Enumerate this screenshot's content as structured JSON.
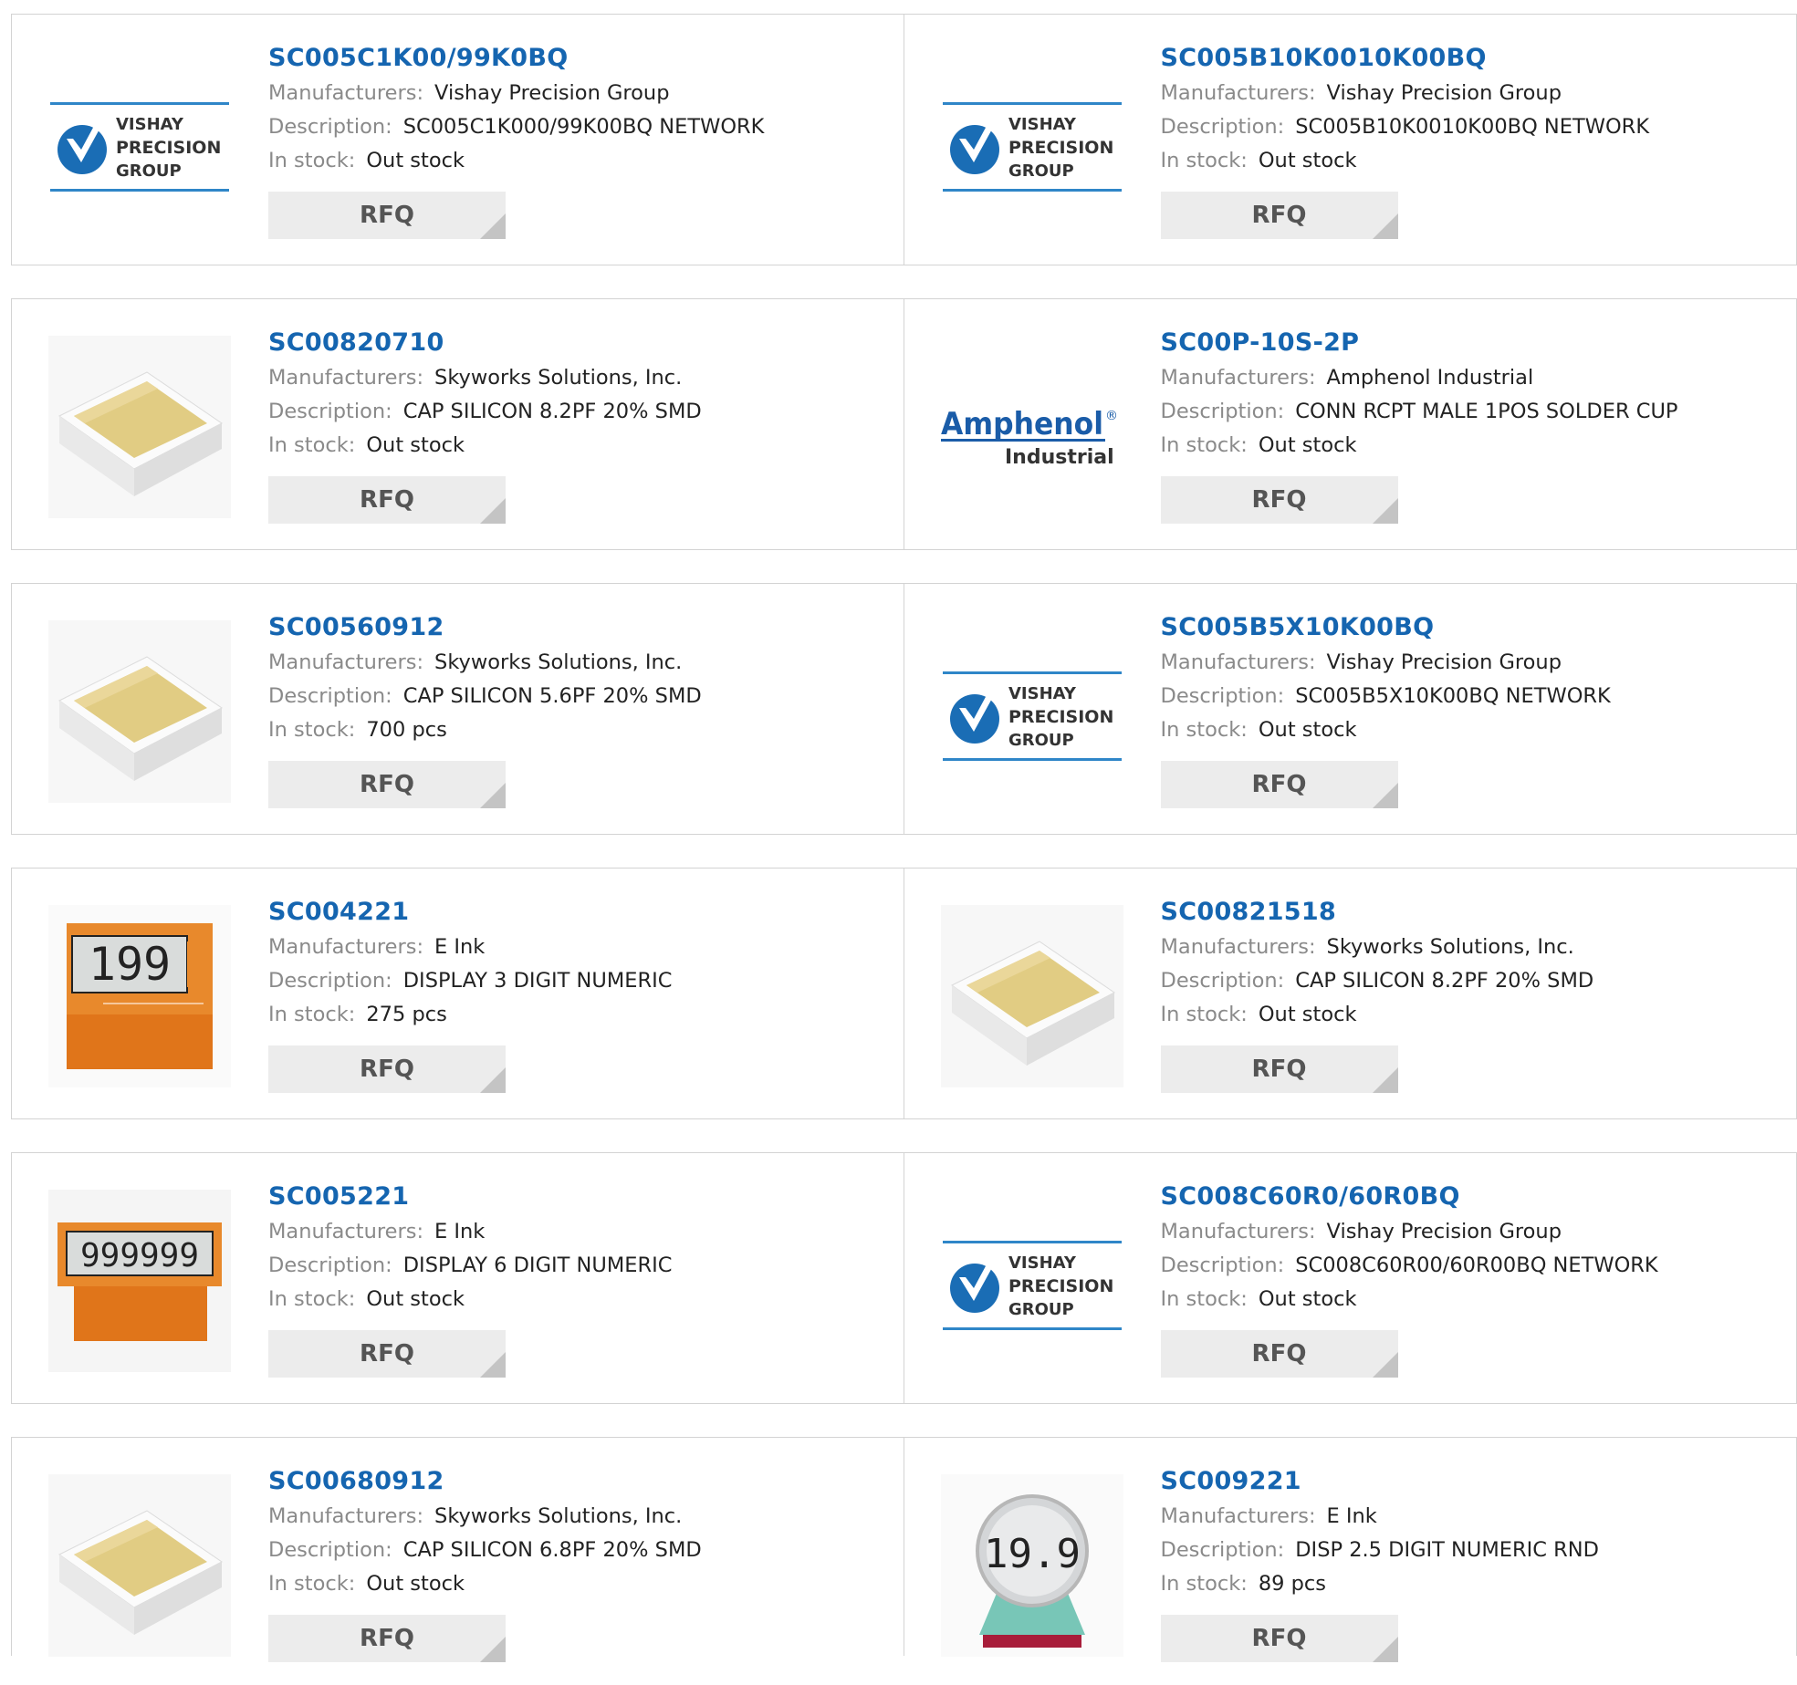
{
  "labels": {
    "manufacturers": "Manufacturers:",
    "description": "Description:",
    "in_stock": "In stock:",
    "rfq": "RFQ"
  },
  "logos": {
    "vishay": {
      "line1": "VISHAY",
      "line2": "PRECISION",
      "line3": "GROUP"
    },
    "amphenol": {
      "word": "Amphenol",
      "reg": "®",
      "sub": "Industrial"
    }
  },
  "colors": {
    "link": "#1565b0",
    "label": "#8a8a8a",
    "rfq_bg": "#ececec",
    "border": "#d3d3d3"
  },
  "products": [
    {
      "part": "SC005C1K00/99K0BQ",
      "manufacturer": "Vishay Precision Group",
      "description": "SC005C1K000/99K00BQ NETWORK",
      "stock": "Out stock",
      "image": "vishay-logo"
    },
    {
      "part": "SC005B10K0010K00BQ",
      "manufacturer": "Vishay Precision Group",
      "description": "SC005B10K0010K00BQ NETWORK",
      "stock": "Out stock",
      "image": "vishay-logo"
    },
    {
      "part": "SC00820710",
      "manufacturer": "Skyworks Solutions, Inc.",
      "description": "CAP SILICON 8.2PF 20% SMD",
      "stock": "Out stock",
      "image": "silicon-cap-chip"
    },
    {
      "part": "SC00P-10S-2P",
      "manufacturer": "Amphenol Industrial",
      "description": "CONN RCPT MALE 1POS SOLDER CUP",
      "stock": "Out stock",
      "image": "amphenol-logo"
    },
    {
      "part": "SC00560912",
      "manufacturer": "Skyworks Solutions, Inc.",
      "description": "CAP SILICON 5.6PF 20% SMD",
      "stock": "700 pcs",
      "image": "silicon-cap-chip"
    },
    {
      "part": "SC005B5X10K00BQ",
      "manufacturer": "Vishay Precision Group",
      "description": "SC005B5X10K00BQ NETWORK",
      "stock": "Out stock",
      "image": "vishay-logo"
    },
    {
      "part": "SC004221",
      "manufacturer": "E Ink",
      "description": "DISPLAY 3 DIGIT NUMERIC",
      "stock": "275 pcs",
      "image": "eink-3-digit-display",
      "digits": "199"
    },
    {
      "part": "SC00821518",
      "manufacturer": "Skyworks Solutions, Inc.",
      "description": "CAP SILICON 8.2PF 20% SMD",
      "stock": "Out stock",
      "image": "silicon-cap-chip"
    },
    {
      "part": "SC005221",
      "manufacturer": "E Ink",
      "description": "DISPLAY 6 DIGIT NUMERIC",
      "stock": "Out stock",
      "image": "eink-6-digit-display",
      "digits": "999999"
    },
    {
      "part": "SC008C60R0/60R0BQ",
      "manufacturer": "Vishay Precision Group",
      "description": "SC008C60R00/60R00BQ NETWORK",
      "stock": "Out stock",
      "image": "vishay-logo"
    },
    {
      "part": "SC00680912",
      "manufacturer": "Skyworks Solutions, Inc.",
      "description": "CAP SILICON 6.8PF 20% SMD",
      "stock": "Out stock",
      "image": "silicon-cap-chip"
    },
    {
      "part": "SC009221",
      "manufacturer": "E Ink",
      "description": "DISP 2.5 DIGIT NUMERIC RND",
      "stock": "89 pcs",
      "image": "eink-round-display",
      "digits": "19.9"
    }
  ]
}
